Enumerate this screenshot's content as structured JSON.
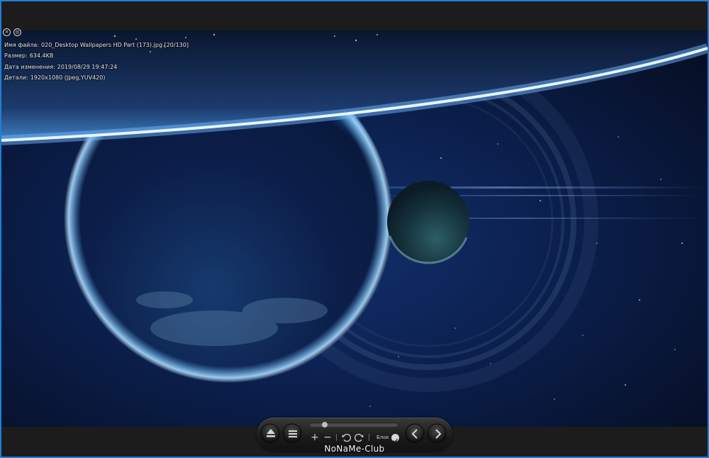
{
  "info": {
    "filename_label": "Имя файла:",
    "filename_value": "020_Desktop Wallpapers HD Part (173).jpg [20/130]",
    "size_label": "Размер:",
    "size_value": "634.4KB",
    "modified_label": "Дата изменения:",
    "modified_value": "2019/08/29 19:47:24",
    "details_label": "Детали:",
    "details_value": "1920x1080 (Jpeg,YUV420)"
  },
  "overlay": {
    "close_icon": "close-icon",
    "settings_icon": "settings-icon"
  },
  "toolbar": {
    "progress_fraction": 0.15,
    "zoom_in_glyph": "+",
    "zoom_out_glyph": "−",
    "lock_label": "Блок",
    "icons": [
      "eject-icon",
      "menu-icon",
      "zoom-in-icon",
      "zoom-out-icon",
      "rotate-left-icon",
      "rotate-right-icon",
      "check-icon",
      "prev-icon",
      "next-icon"
    ]
  },
  "watermark": "NoNaMe-Club",
  "colors": {
    "window_border": "#1f7fd6",
    "chrome": "#1c1c1c",
    "space": "#0b1a3a",
    "atmosphere_glow": "#bfe6ff"
  }
}
